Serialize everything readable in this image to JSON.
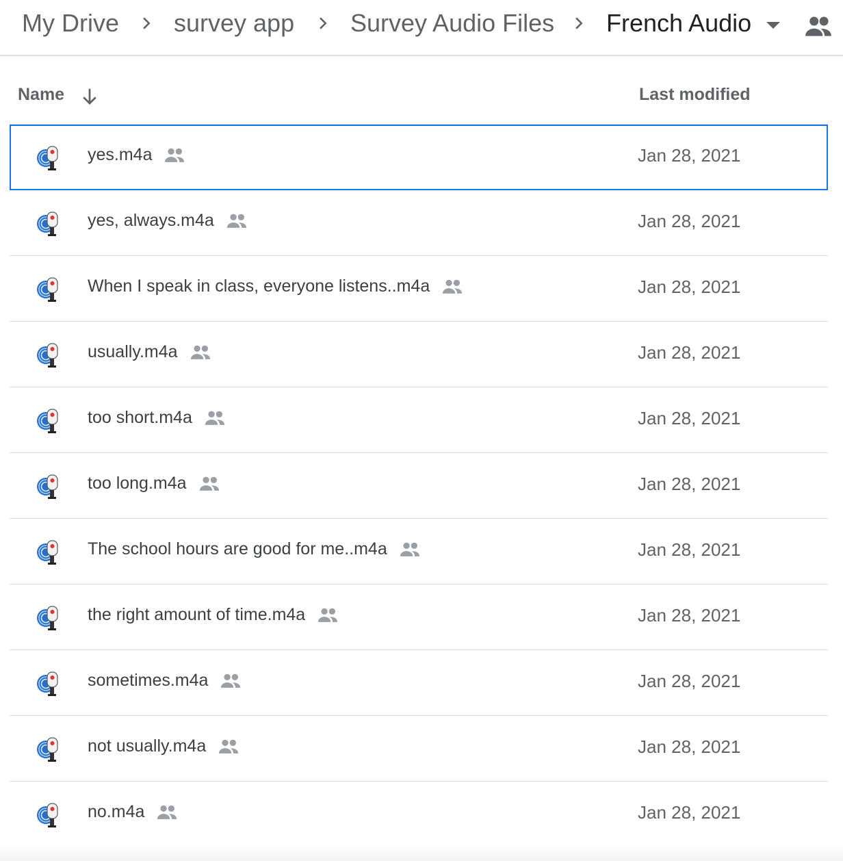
{
  "breadcrumb": {
    "items": [
      "My Drive",
      "survey app",
      "Survey Audio Files",
      "French Audio"
    ],
    "dropdown_icon": "arrow-drop-down-icon",
    "shared_icon": "people-icon"
  },
  "columns": {
    "name": "Name",
    "last_modified": "Last modified",
    "sort_icon": "arrow-down-icon"
  },
  "files": [
    {
      "name": "yes.m4a",
      "modified": "Jan 28, 2021",
      "shared": true,
      "selected": true
    },
    {
      "name": "yes, always.m4a",
      "modified": "Jan 28, 2021",
      "shared": true
    },
    {
      "name": "When I speak in class, everyone listens..m4a",
      "modified": "Jan 28, 2021",
      "shared": true
    },
    {
      "name": "usually.m4a",
      "modified": "Jan 28, 2021",
      "shared": true
    },
    {
      "name": "too short.m4a",
      "modified": "Jan 28, 2021",
      "shared": true
    },
    {
      "name": "too long.m4a",
      "modified": "Jan 28, 2021",
      "shared": true
    },
    {
      "name": "The school hours are good for me..m4a",
      "modified": "Jan 28, 2021",
      "shared": true
    },
    {
      "name": "the right amount of time.m4a",
      "modified": "Jan 28, 2021",
      "shared": true
    },
    {
      "name": "sometimes.m4a",
      "modified": "Jan 28, 2021",
      "shared": true
    },
    {
      "name": "not usually.m4a",
      "modified": "Jan 28, 2021",
      "shared": true
    },
    {
      "name": "no.m4a",
      "modified": "Jan 28, 2021",
      "shared": true
    }
  ],
  "colors": {
    "selected_border": "#1a73e8",
    "divider": "#dadce0",
    "icon_gray": "#9aa0a6"
  }
}
